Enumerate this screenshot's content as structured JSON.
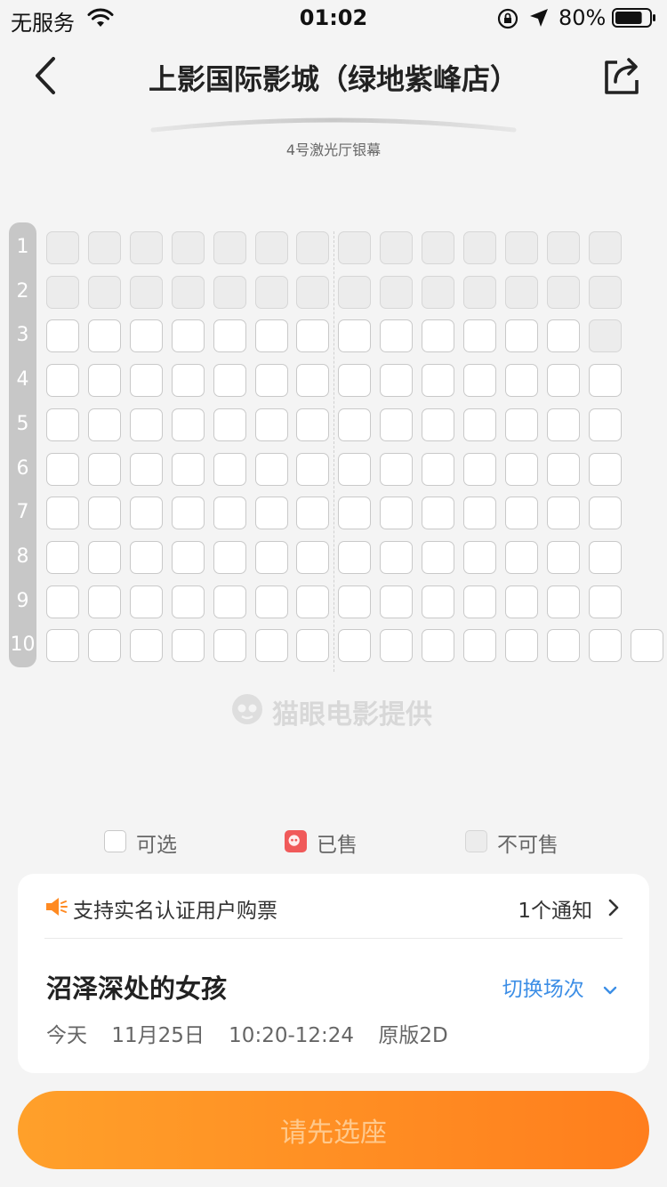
{
  "status_bar": {
    "carrier": "无服务",
    "time": "01:02",
    "battery": "80%",
    "battery_level": 0.8
  },
  "header": {
    "title": "上影国际影城（绿地紫峰店）"
  },
  "screen": {
    "label": "4号激光厅银幕"
  },
  "seat_map": {
    "rows": [
      "1",
      "2",
      "3",
      "4",
      "5",
      "6",
      "7",
      "8",
      "9",
      "10"
    ],
    "seat_states": [
      [
        "x",
        "x",
        "x",
        "x",
        "x",
        "x",
        "x",
        "x",
        "x",
        "x",
        "x",
        "x",
        "x",
        "x"
      ],
      [
        "x",
        "x",
        "x",
        "x",
        "x",
        "x",
        "x",
        "x",
        "x",
        "x",
        "x",
        "x",
        "x",
        "x"
      ],
      [
        "a",
        "a",
        "a",
        "a",
        "a",
        "a",
        "a",
        "a",
        "a",
        "a",
        "a",
        "a",
        "a",
        "x"
      ],
      [
        "a",
        "a",
        "a",
        "a",
        "a",
        "a",
        "a",
        "a",
        "a",
        "a",
        "a",
        "a",
        "a",
        "a"
      ],
      [
        "a",
        "a",
        "a",
        "a",
        "a",
        "a",
        "a",
        "a",
        "a",
        "a",
        "a",
        "a",
        "a",
        "a"
      ],
      [
        "a",
        "a",
        "a",
        "a",
        "a",
        "a",
        "a",
        "a",
        "a",
        "a",
        "a",
        "a",
        "a",
        "a"
      ],
      [
        "a",
        "a",
        "a",
        "a",
        "a",
        "a",
        "a",
        "a",
        "a",
        "a",
        "a",
        "a",
        "a",
        "a"
      ],
      [
        "a",
        "a",
        "a",
        "a",
        "a",
        "a",
        "a",
        "a",
        "a",
        "a",
        "a",
        "a",
        "a",
        "a"
      ],
      [
        "a",
        "a",
        "a",
        "a",
        "a",
        "a",
        "a",
        "a",
        "a",
        "a",
        "a",
        "a",
        "a",
        "a"
      ],
      [
        "a",
        "a",
        "a",
        "a",
        "a",
        "a",
        "a",
        "a",
        "a",
        "a",
        "a",
        "a",
        "a",
        "a",
        "a"
      ]
    ],
    "watermark": "猫眼电影提供"
  },
  "legend": {
    "available": "可选",
    "sold": "已售",
    "unavailable": "不可售"
  },
  "notice": {
    "text": "支持实名认证用户购票",
    "count": "1个通知"
  },
  "movie": {
    "title": "沼泽深处的女孩",
    "switch_label": "切换场次",
    "day": "今天",
    "date": "11月25日",
    "time_range": "10:20-12:24",
    "format": "原版2D"
  },
  "cta": {
    "label": "请先选座"
  },
  "colors": {
    "accent_orange": "#ff8a22",
    "link_blue": "#3c8ee6",
    "sold_red": "#f05a5a"
  },
  "icons": [
    "wifi-icon",
    "lock-rotation-icon",
    "location-arrow-icon",
    "battery-icon",
    "back-chevron-icon",
    "share-icon",
    "maoyan-cat-icon",
    "megaphone-icon",
    "chevron-right-icon",
    "chevron-down-icon"
  ]
}
